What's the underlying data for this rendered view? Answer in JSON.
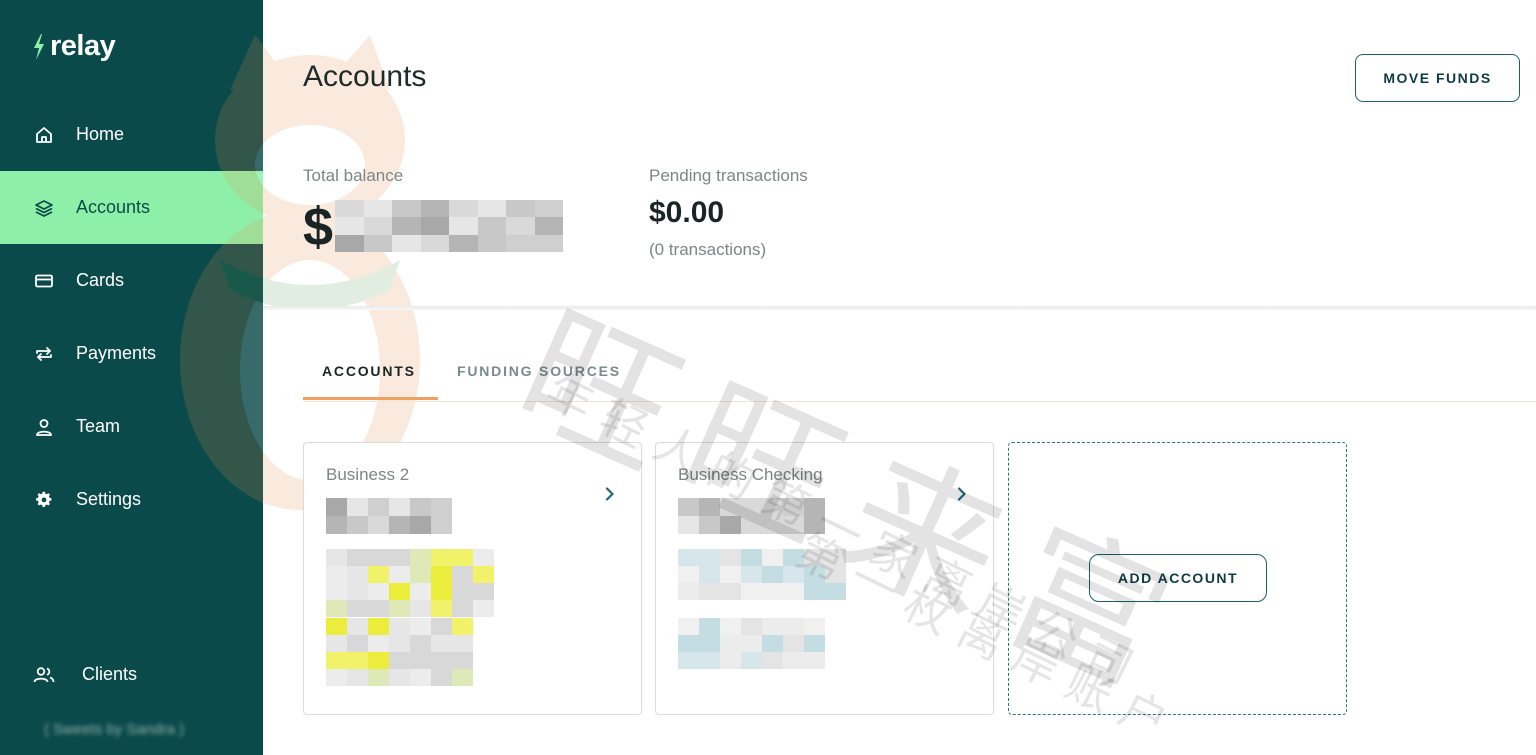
{
  "app": {
    "logo_text": "relay",
    "brand_colors": {
      "sidebar": "#0b4a4a",
      "active": "#8ef0a8",
      "tab_accent": "#f0a060"
    }
  },
  "sidebar": {
    "items": [
      {
        "label": "Home",
        "icon": "home-icon",
        "active": false
      },
      {
        "label": "Accounts",
        "icon": "layers-icon",
        "active": true
      },
      {
        "label": "Cards",
        "icon": "card-icon",
        "active": false
      },
      {
        "label": "Payments",
        "icon": "repeat-icon",
        "active": false
      },
      {
        "label": "Team",
        "icon": "user-icon",
        "active": false
      },
      {
        "label": "Settings",
        "icon": "gear-icon",
        "active": false
      }
    ],
    "bottom": {
      "label": "Clients",
      "icon": "users-icon"
    },
    "client_name": "( Sweets by Sandra )"
  },
  "header": {
    "title": "Accounts",
    "move_funds_label": "MOVE FUNDS"
  },
  "stats": {
    "total_balance_label": "Total balance",
    "total_balance_currency": "$",
    "pending_label": "Pending transactions",
    "pending_value": "$0.00",
    "pending_count": "(0 transactions)"
  },
  "tabs": [
    {
      "label": "ACCOUNTS",
      "active": true
    },
    {
      "label": "FUNDING SOURCES",
      "active": false
    }
  ],
  "accounts": [
    {
      "name": "Business 2"
    },
    {
      "name": "Business Checking"
    }
  ],
  "add_account_label": "ADD ACCOUNT",
  "watermark": {
    "main": "旺旺来富",
    "line1": "年轻人的第一家离岸公司",
    "line2": "第一枚离岸账户"
  }
}
